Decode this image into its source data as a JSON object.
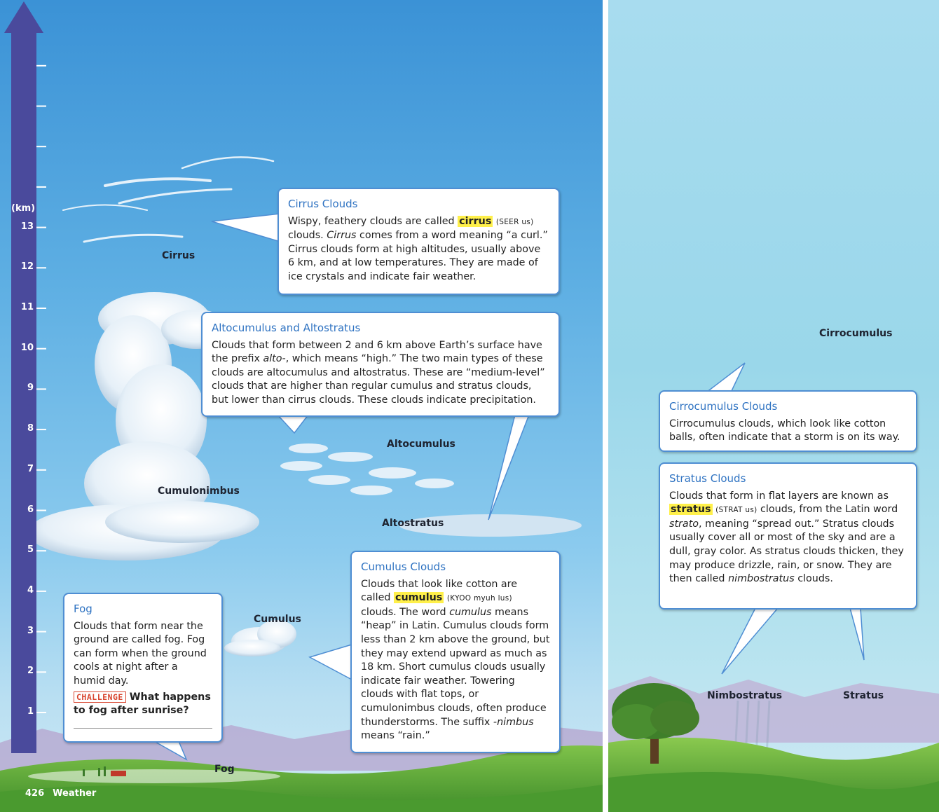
{
  "axis": {
    "unit": "(km)",
    "ticks": [
      "1",
      "2",
      "3",
      "4",
      "5",
      "6",
      "7",
      "8",
      "9",
      "10",
      "11",
      "12",
      "13"
    ]
  },
  "folio": {
    "page_number": "426",
    "section": "Weather"
  },
  "labels": {
    "cirrus": "Cirrus",
    "cumulonimbus": "Cumulonimbus",
    "altocumulus": "Altocumulus",
    "altostratus": "Altostratus",
    "cumulus": "Cumulus",
    "fog": "Fog",
    "cirrocumulus": "Cirrocumulus",
    "nimbostratus": "Nimbostratus",
    "stratus": "Stratus"
  },
  "boxes": {
    "cirrus": {
      "title": "Cirrus Clouds",
      "t1": "Wispy, feathery clouds are called ",
      "term": "cirrus",
      "pron": "(SEER us)",
      "t2": " clouds. ",
      "t2i": "Cirrus",
      "t3": " comes from a word meaning “a curl.” Cirrus clouds form at high altitudes, usually above 6 km, and at low temperatures. They are made of ice crystals and indicate fair weather."
    },
    "alto": {
      "title": "Altocumulus and Altostratus",
      "t1": "Clouds that form between 2 and 6 km above Earth’s surface have the prefix ",
      "t1i": "alto-",
      "t2": ", which means “high.” The two main types of these clouds are altocumulus and altostratus. These are “medium-level” clouds that are higher than regular cumulus and stratus clouds, but lower than cirrus clouds. These clouds indicate precipitation."
    },
    "cumulus": {
      "title": "Cumulus Clouds",
      "t1": "Clouds that look like cotton are called ",
      "term": "cumulus",
      "pron": "(KYOO myuh lus)",
      "t2": " clouds. The word ",
      "t2i": "cumulus",
      "t3": " means “heap” in Latin. Cumulus clouds form less than 2 km above the ground, but they may extend upward as much as 18 km. Short cumulus clouds usually indicate fair weather. Towering clouds with flat tops, or cumulonimbus clouds, often produce thunderstorms. The suffix ",
      "t3i": "-nimbus",
      "t4": " means “rain.”"
    },
    "fog": {
      "title": "Fog",
      "text": "Clouds that form near the ground are called fog. Fog can form when the ground cools at night after a humid day.",
      "challenge": "CHALLENGE",
      "question": " What happens to fog after sunrise?"
    },
    "cirrocumulus": {
      "title": "Cirrocumulus Clouds",
      "text": "Cirrocumulus clouds, which look like cotton balls, often indicate that a storm is on its way."
    },
    "stratus": {
      "title": "Stratus Clouds",
      "t1": "Clouds that form in flat layers are known as ",
      "term": "stratus",
      "pron": "(STRAT us)",
      "t2": " clouds, from the Latin word ",
      "t2i": "strato",
      "t3": ", meaning “spread out.” Stratus clouds usually cover all or most of the sky and are a dull, gray color. As stratus clouds thicken, they may produce drizzle, rain, or snow. They are then called ",
      "t3i": "nimbostratus",
      "t4": " clouds."
    }
  }
}
